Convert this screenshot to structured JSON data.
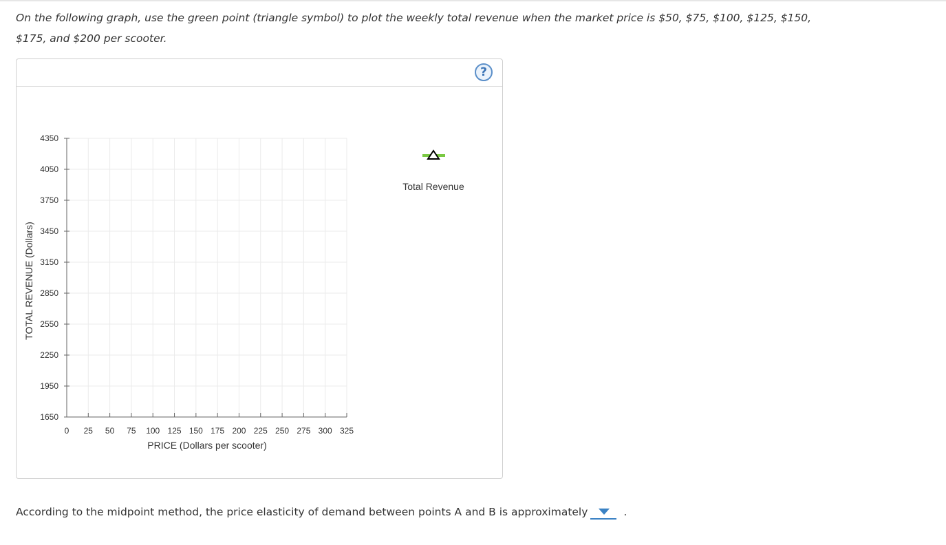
{
  "instructions": {
    "line1": "On the following graph, use the green point (triangle symbol) to plot the weekly total revenue when the market price is $50, $75, $100, $125, $150,",
    "line2": "$175, and $200 per scooter."
  },
  "graph": {
    "help_label": "?",
    "legend_label": "Total Revenue"
  },
  "chart_data": {
    "type": "scatter",
    "xlabel": "PRICE (Dollars per scooter)",
    "ylabel": "TOTAL REVENUE (Dollars)",
    "xlim": [
      0,
      325
    ],
    "ylim": [
      1650,
      4350
    ],
    "xticks": [
      0,
      25,
      50,
      75,
      100,
      125,
      150,
      175,
      200,
      225,
      250,
      275,
      300,
      325
    ],
    "yticks": [
      1650,
      1950,
      2250,
      2550,
      2850,
      3150,
      3450,
      3750,
      4050,
      4350
    ],
    "grid": true,
    "series": [
      {
        "name": "Total Revenue",
        "marker": "triangle",
        "color": "#7ac943",
        "points": []
      }
    ]
  },
  "question": {
    "text": "According to the midpoint method, the price elasticity of demand between points A and B is approximately",
    "selected": "",
    "trailing": "."
  },
  "colors": {
    "accent": "#3b82c4",
    "marker": "#7ac943",
    "grid": "#ebebeb"
  }
}
